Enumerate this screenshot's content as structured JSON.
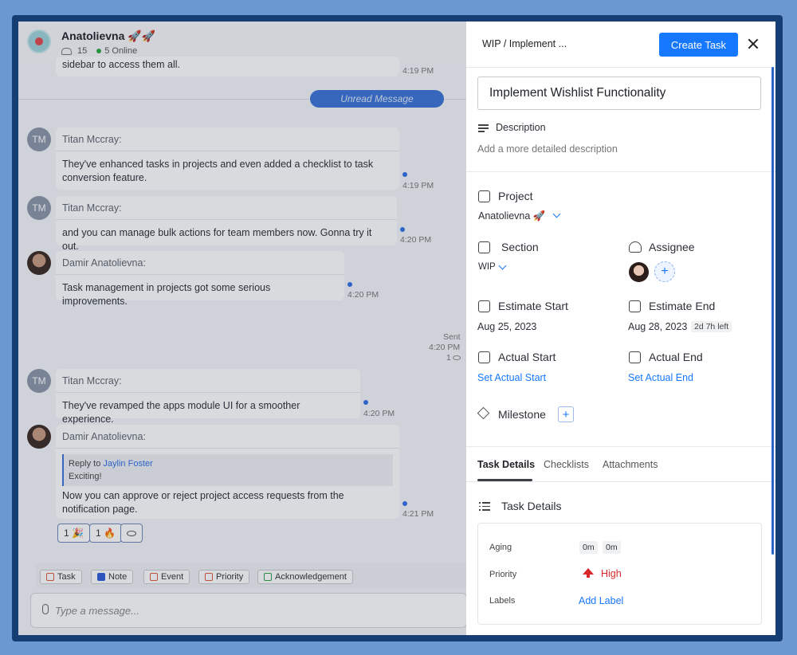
{
  "chat": {
    "title": "Anatolievna 🚀🚀",
    "member_count": "15",
    "online": "5 Online",
    "partial_text": "sidebar to access them all.",
    "partial_time": "4:19 PM",
    "unread_label": "Unread Message",
    "messages": [
      {
        "initials": "TM",
        "name": "Titan Mccray:",
        "text": "They've enhanced tasks in projects and even added a checklist to task conversion feature.",
        "time": "4:19 PM"
      },
      {
        "initials": "TM",
        "name": "Titan Mccray:",
        "text": "and you can manage bulk actions for team members now. Gonna try it out.",
        "time": "4:20 PM"
      },
      {
        "initials": "",
        "name": "Damir Anatolievna:",
        "text": "Task management in projects got some serious improvements.",
        "time": "4:20 PM"
      },
      {
        "initials": "TM",
        "name": "Titan Mccray:",
        "text": "They've revamped the apps module UI for a smoother experience.",
        "time": "4:20 PM"
      },
      {
        "initials": "",
        "name": "Damir Anatolievna:",
        "reply_prefix": "Reply to",
        "reply_to": "Jaylin Foster",
        "reply_text": "Exciting!",
        "text": "Now you can approve or reject project access requests from the notification page.",
        "time": "4:21 PM"
      }
    ],
    "sent": {
      "label": "Sent",
      "time": "4:20 PM",
      "views": "1"
    },
    "reactions": [
      "1 🎉",
      "1 🔥"
    ],
    "chips": [
      "Task",
      "Note",
      "Event",
      "Priority",
      "Acknowledgement"
    ],
    "composer_placeholder": "Type a message..."
  },
  "panel": {
    "breadcrumb": "WIP  / Implement ...",
    "create_button": "Create Task",
    "task_title": "Implement Wishlist Functionality",
    "description_label": "Description",
    "description_placeholder": "Add a more detailed description",
    "project_label": "Project",
    "project_value": "Anatolievna 🚀",
    "section_label": "Section",
    "section_value": "WIP",
    "assignee_label": "Assignee",
    "estimate_start_label": "Estimate Start",
    "estimate_start_value": "Aug 25, 2023",
    "estimate_end_label": "Estimate End",
    "estimate_end_value": "Aug 28, 2023",
    "time_left": "2d 7h left",
    "actual_start_label": "Actual Start",
    "actual_start_link": "Set Actual Start",
    "actual_end_label": "Actual End",
    "actual_end_link": "Set Actual End",
    "milestone_label": "Milestone",
    "tabs": [
      "Task Details",
      "Checklists",
      "Attachments"
    ],
    "details_title": "Task Details",
    "aging_label": "Aging",
    "aging_values": [
      "0m",
      "0m"
    ],
    "priority_label": "Priority",
    "priority_value": "High",
    "labels_label": "Labels",
    "add_label": "Add Label"
  },
  "colors": {
    "accent": "#1677ff",
    "priority_high": "#d8262a",
    "frame": "#153f74",
    "background": "#6b98d0"
  }
}
